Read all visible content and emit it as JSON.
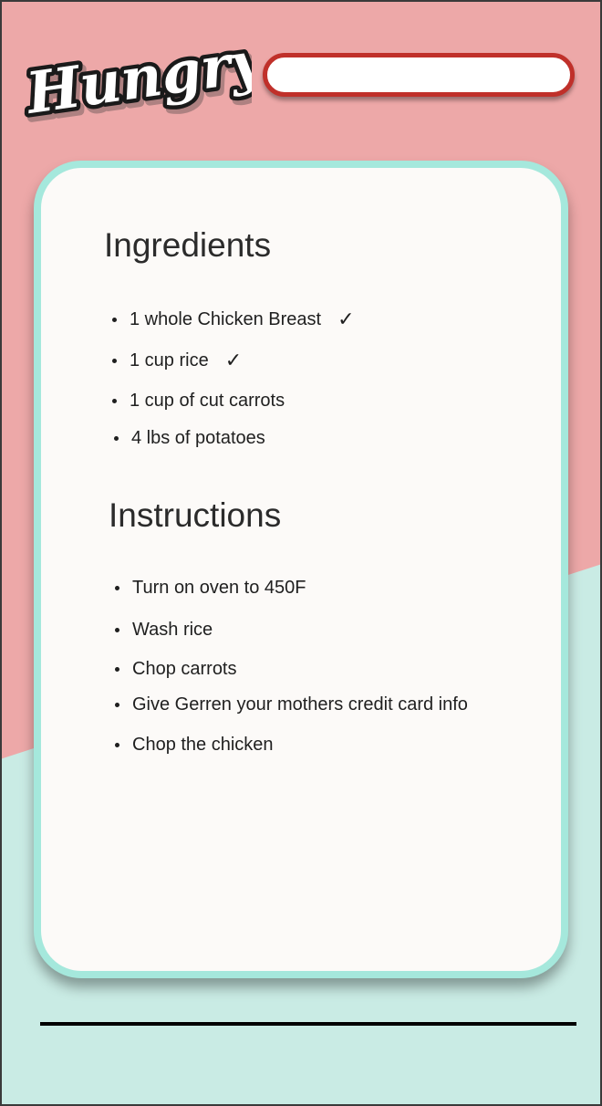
{
  "app": {
    "logo_text": "Hungry"
  },
  "search": {
    "value": "",
    "placeholder": ""
  },
  "ingredients": {
    "title": "Ingredients",
    "items": [
      {
        "text": "1 whole Chicken Breast",
        "checked": true
      },
      {
        "text": "1 cup rice",
        "checked": true
      },
      {
        "text": "1 cup of cut carrots",
        "checked": false
      },
      {
        "text": "4 lbs of potatoes",
        "checked": false
      }
    ]
  },
  "instructions": {
    "title": "Instructions",
    "items": [
      {
        "text": "Turn on oven to 450F"
      },
      {
        "text": "Wash rice"
      },
      {
        "text": "Chop carrots"
      },
      {
        "text": "Give Gerren your mothers credit card info"
      },
      {
        "text": "Chop the chicken"
      }
    ]
  },
  "check_glyph": "✓",
  "colors": {
    "top_background": "#eda8a8",
    "bottom_background": "#c9ebe4",
    "card_border": "#a5e8dc",
    "card_fill": "#fcfaf8",
    "search_border": "#c0302a"
  }
}
